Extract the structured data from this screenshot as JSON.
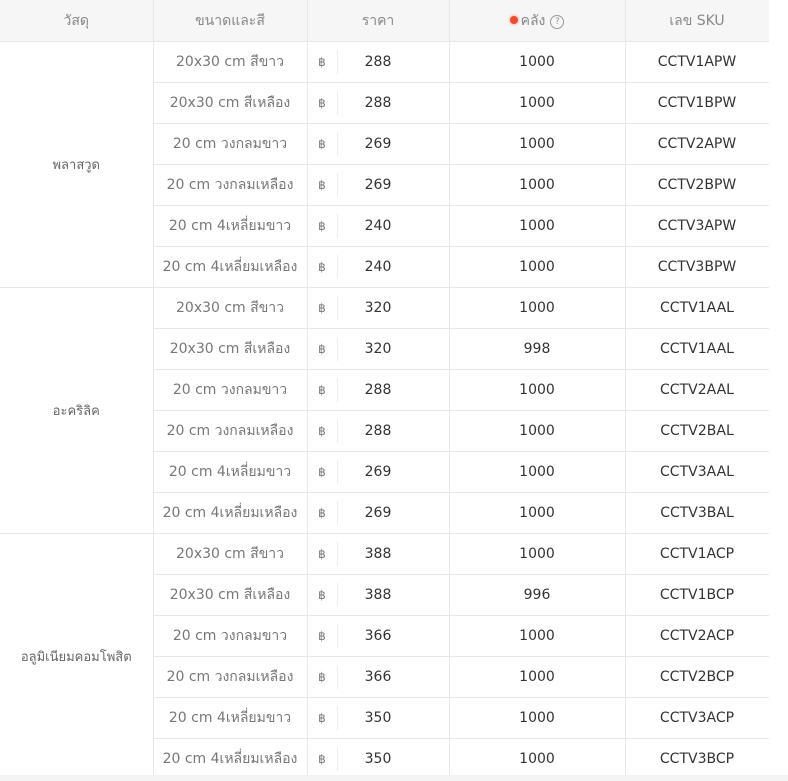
{
  "headers": {
    "material": "วัสดุ",
    "size_color": "ขนาดและสี",
    "price": "ราคา",
    "stock": "คลัง",
    "sku": "เลข SKU",
    "help_glyph": "?"
  },
  "currency_symbol": "฿",
  "accent_color": "#ee4d2d",
  "groups": [
    {
      "material": "พลาสวูด",
      "rows": [
        {
          "size": "20x30 cm สีขาว",
          "price": "288",
          "stock": "1000",
          "sku": "CCTV1APW"
        },
        {
          "size": "20x30 cm สีเหลือง",
          "price": "288",
          "stock": "1000",
          "sku": "CCTV1BPW"
        },
        {
          "size": "20 cm วงกลมขาว",
          "price": "269",
          "stock": "1000",
          "sku": "CCTV2APW"
        },
        {
          "size": "20 cm วงกลมเหลือง",
          "price": "269",
          "stock": "1000",
          "sku": "CCTV2BPW"
        },
        {
          "size": "20 cm 4เหลี่ยมขาว",
          "price": "240",
          "stock": "1000",
          "sku": "CCTV3APW"
        },
        {
          "size": "20 cm 4เหลี่ยมเหลือง",
          "price": "240",
          "stock": "1000",
          "sku": "CCTV3BPW"
        }
      ]
    },
    {
      "material": "อะคริลิค",
      "rows": [
        {
          "size": "20x30 cm สีขาว",
          "price": "320",
          "stock": "1000",
          "sku": "CCTV1AAL"
        },
        {
          "size": "20x30 cm สีเหลือง",
          "price": "320",
          "stock": "998",
          "sku": "CCTV1AAL"
        },
        {
          "size": "20 cm วงกลมขาว",
          "price": "288",
          "stock": "1000",
          "sku": "CCTV2AAL"
        },
        {
          "size": "20 cm วงกลมเหลือง",
          "price": "288",
          "stock": "1000",
          "sku": "CCTV2BAL"
        },
        {
          "size": "20 cm 4เหลี่ยมขาว",
          "price": "269",
          "stock": "1000",
          "sku": "CCTV3AAL"
        },
        {
          "size": "20 cm 4เหลี่ยมเหลือง",
          "price": "269",
          "stock": "1000",
          "sku": "CCTV3BAL"
        }
      ]
    },
    {
      "material": "อลูมิเนียมคอมโพสิต",
      "rows": [
        {
          "size": "20x30 cm สีขาว",
          "price": "388",
          "stock": "1000",
          "sku": "CCTV1ACP"
        },
        {
          "size": "20x30 cm สีเหลือง",
          "price": "388",
          "stock": "996",
          "sku": "CCTV1BCP"
        },
        {
          "size": "20 cm วงกลมขาว",
          "price": "366",
          "stock": "1000",
          "sku": "CCTV2ACP"
        },
        {
          "size": "20 cm วงกลมเหลือง",
          "price": "366",
          "stock": "1000",
          "sku": "CCTV2BCP"
        },
        {
          "size": "20 cm 4เหลี่ยมขาว",
          "price": "350",
          "stock": "1000",
          "sku": "CCTV3ACP"
        },
        {
          "size": "20 cm 4เหลี่ยมเหลือง",
          "price": "350",
          "stock": "1000",
          "sku": "CCTV3BCP"
        }
      ]
    }
  ]
}
